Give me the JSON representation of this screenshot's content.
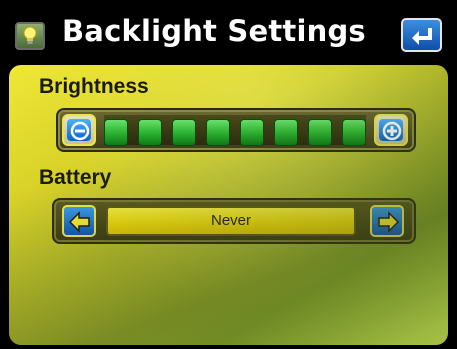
{
  "header": {
    "title": "Backlight Settings",
    "app_icon": "lightbulb-icon",
    "back_icon": "return-arrow-icon"
  },
  "brightness": {
    "label": "Brightness",
    "decrease_icon": "minus-icon",
    "increase_icon": "plus-icon",
    "level": 8,
    "max_level": 8
  },
  "battery": {
    "label": "Battery",
    "value": "Never",
    "prev_icon": "left-arrow-icon",
    "next_icon": "right-arrow-icon"
  },
  "colors": {
    "accent_blue": "#1f78d8",
    "segment_green": "#2db532",
    "field_yellow": "#f0dc12",
    "panel_yellow": "#d9d228"
  }
}
